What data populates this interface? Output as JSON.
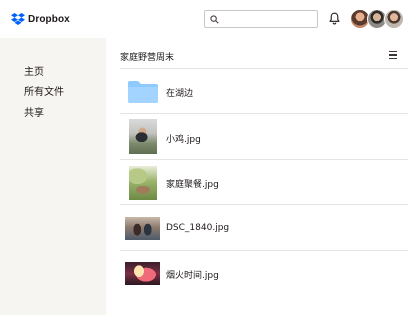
{
  "app": {
    "brand": "Dropbox",
    "brand_color": "#0061FE"
  },
  "search": {
    "placeholder": "",
    "value": ""
  },
  "icons": {
    "search": "search-icon",
    "bell": "bell-icon",
    "menu": "menu-icon",
    "folder": "folder-icon"
  },
  "sidebar": {
    "items": [
      {
        "label": "主页"
      },
      {
        "label": "所有文件"
      },
      {
        "label": "共享"
      }
    ]
  },
  "main": {
    "breadcrumb": "家庭野营周末",
    "files": [
      {
        "name": "在湖边",
        "type": "folder"
      },
      {
        "name": "小鸡.jpg",
        "type": "image"
      },
      {
        "name": "家庭聚餐.jpg",
        "type": "image"
      },
      {
        "name": "DSC_1840.jpg",
        "type": "image"
      },
      {
        "name": "烟火时间.jpg",
        "type": "image"
      }
    ]
  },
  "colors": {
    "sidebar_bg": "#F7F5F2",
    "folder": "#8FCAFE",
    "divider": "#E6E4E2"
  }
}
